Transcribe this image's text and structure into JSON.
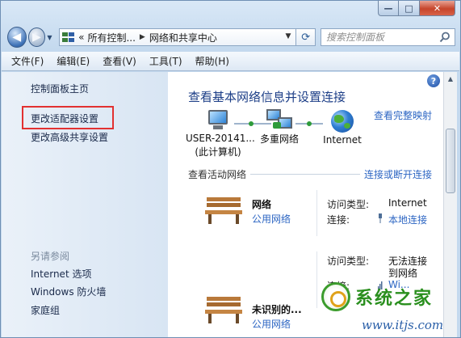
{
  "window": {
    "caption": {
      "minimize": "—",
      "maximize": "□",
      "close": "✕"
    }
  },
  "nav": {
    "address_parts": [
      "«",
      "所有控制...",
      "网络和共享中心"
    ],
    "search_placeholder": "搜索控制面板"
  },
  "menu": [
    "文件(F)",
    "编辑(E)",
    "查看(V)",
    "工具(T)",
    "帮助(H)"
  ],
  "sidebar": {
    "home": "控制面板主页",
    "items": [
      "更改适配器设置",
      "更改高级共享设置"
    ],
    "see_also_title": "另请参阅",
    "see_also": [
      "Internet 选项",
      "Windows 防火墙",
      "家庭组"
    ]
  },
  "content": {
    "title": "查看基本网络信息并设置连接",
    "full_map": "查看完整映射",
    "nodes": [
      {
        "label_line1": "USER-20141...",
        "label_line2": "(此计算机)",
        "icon": "computer-icon"
      },
      {
        "label_line1": "多重网络",
        "label_line2": "",
        "icon": "multiple-networks-icon"
      },
      {
        "label_line1": "Internet",
        "label_line2": "",
        "icon": "globe-icon"
      }
    ],
    "active_networks_label": "查看活动网络",
    "connect_disconnect": "连接或断开连接",
    "networks": [
      {
        "name": "网络",
        "type": "公用网络",
        "access_label": "访问类型:",
        "access_value": "Internet",
        "conn_label": "连接:",
        "conn_value": "本地连接"
      },
      {
        "name": "未识别的...",
        "type": "公用网络",
        "access_label": "访问类型:",
        "access_value_line1": "无法连接",
        "access_value_line2": "到网络",
        "conn_label": "连接:",
        "conn_value": "Wi..."
      }
    ]
  },
  "watermark": {
    "text": "系统之家",
    "url": "www.itjs.com"
  }
}
